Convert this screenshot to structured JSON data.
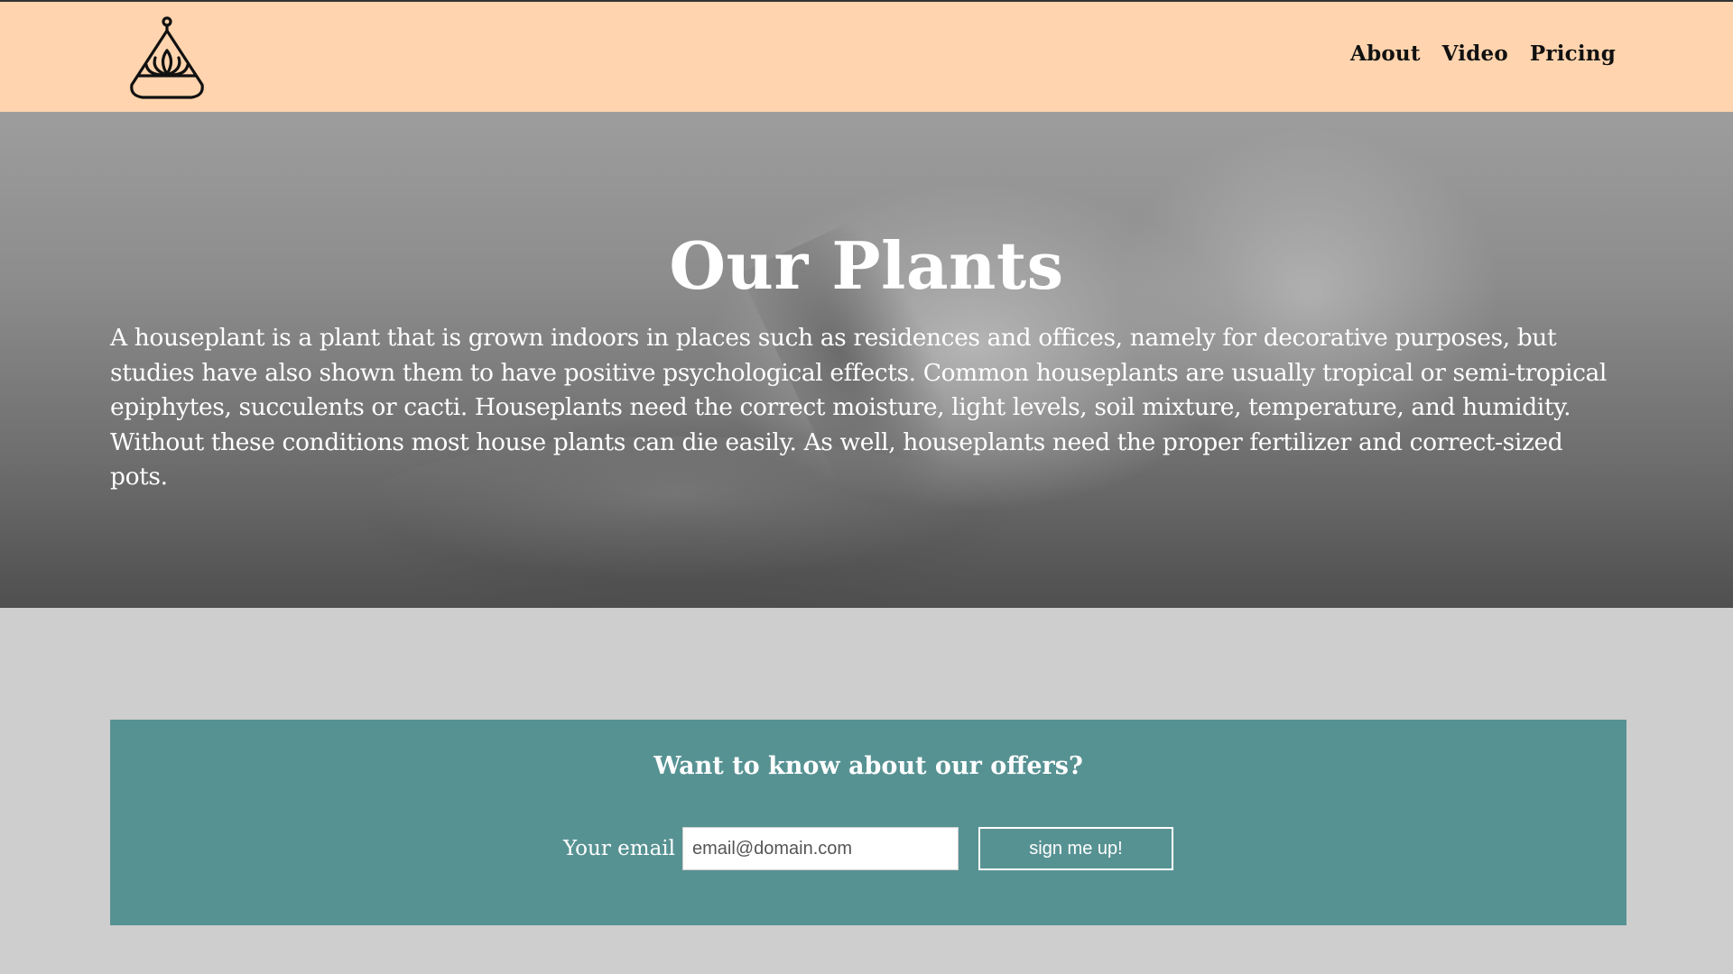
{
  "header": {
    "logo_icon": "plant-pot-icon",
    "nav": {
      "about": "About",
      "video": "Video",
      "pricing": "Pricing"
    }
  },
  "hero": {
    "title": "Our Plants",
    "description": "A houseplant is a plant that is grown indoors in places such as residences and offices, namely for decorative purposes, but studies have also shown them to have positive psychological effects. Common houseplants are usually tropical or semi-tropical epiphytes, succulents or cacti. Houseplants need the correct moisture, light levels, soil mixture, temperature, and humidity. Without these conditions most house plants can die easily. As well, houseplants need the proper fertilizer and correct-sized pots."
  },
  "offers": {
    "title": "Want to know about our offers?",
    "email_label": "Your email",
    "email_placeholder": "email@domain.com",
    "button_label": "sign me up!"
  },
  "colors": {
    "header_bg": "#ffd4ae",
    "page_bg": "#cecece",
    "offers_bg": "#579293"
  }
}
